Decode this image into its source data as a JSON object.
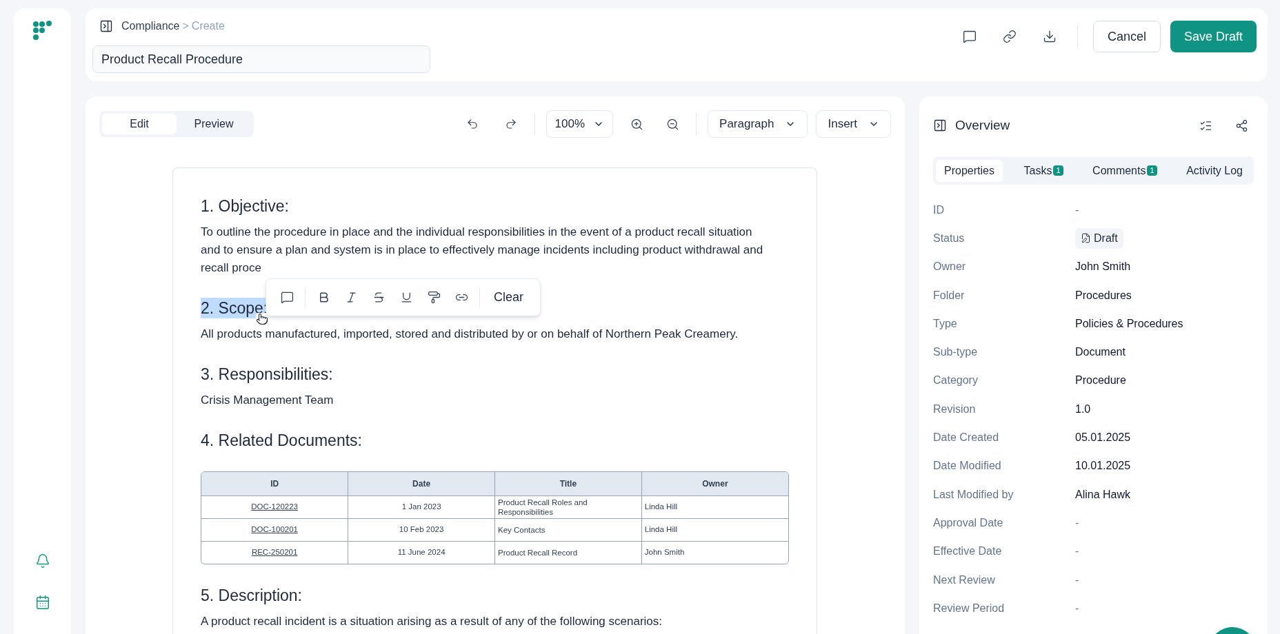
{
  "header": {
    "breadcrumb": [
      {
        "label": "Compliance",
        "current": false
      },
      {
        "label": "Create",
        "current": true
      }
    ],
    "breadcrumb_separator": ">",
    "title_field": {
      "value": "Product Recall Procedure"
    },
    "buttons": [
      {
        "label": "Cancel",
        "kind": "secondary"
      },
      {
        "label": "Save Draft",
        "kind": "primary"
      }
    ]
  },
  "editor": {
    "mode_tabs": [
      {
        "label": "Edit",
        "selected": true
      },
      {
        "label": "Preview",
        "selected": false
      }
    ],
    "zoom": "100%",
    "dropdowns": [
      "Paragraph",
      "Insert"
    ],
    "format_toolbar": {
      "clear": "Clear"
    },
    "blocks": [
      {
        "kind": "heading",
        "text": "1. Objective:",
        "selected": false
      },
      {
        "kind": "paragraph",
        "lines": [
          "To outline the procedure in place and the individual responsibilities in the event of a product recall situation",
          "and to ensure a plan and system is in place to effectively manage incidents including product withdrawal and",
          "recall proce"
        ]
      },
      {
        "kind": "heading",
        "text": "2. Scope:",
        "selected": true
      },
      {
        "kind": "paragraph",
        "lines": [
          "All products manufactured, imported, stored and distributed by or on behalf of Northern Peak Creamery."
        ]
      },
      {
        "kind": "heading",
        "text": "3. Responsibilities:",
        "selected": false
      },
      {
        "kind": "paragraph",
        "lines": [
          "Crisis Management Team"
        ]
      },
      {
        "kind": "heading",
        "text": "4. Related Documents:",
        "selected": false
      },
      {
        "kind": "table",
        "columns": [
          "ID",
          "Date",
          "Title",
          "Owner"
        ],
        "rows": [
          [
            "DOC-120223",
            "1 Jan 2023",
            "Product Recall Roles and Responsibilities",
            "Linda Hill"
          ],
          [
            "DOC-100201",
            "10 Feb 2023",
            "Key Contacts",
            "Linda Hill"
          ],
          [
            "REC-250201",
            "11 June 2024",
            "Product Recall Record",
            "John Smith"
          ]
        ]
      },
      {
        "kind": "heading",
        "text": "5. Description:",
        "selected": false
      },
      {
        "kind": "paragraph",
        "lines": [
          "A product recall incident is a situation arising as a result of any of the following scenarios:"
        ]
      }
    ]
  },
  "overview": {
    "title": "Overview",
    "tabs": [
      {
        "label": "Properties",
        "selected": true
      },
      {
        "label": "Tasks",
        "selected": false,
        "count": "1"
      },
      {
        "label": "Comments",
        "selected": false,
        "count": "1"
      },
      {
        "label": "Activity Log",
        "selected": false
      }
    ],
    "properties": [
      {
        "label": "ID",
        "value": "-",
        "kind": "text"
      },
      {
        "label": "Status",
        "value": "Draft",
        "kind": "badge"
      },
      {
        "label": "Owner",
        "value": "John Smith",
        "kind": "text"
      },
      {
        "label": "Folder",
        "value": "Procedures",
        "kind": "text"
      },
      {
        "label": "Type",
        "value": "Policies & Procedures",
        "kind": "text"
      },
      {
        "label": "Sub-type",
        "value": "Document",
        "kind": "text"
      },
      {
        "label": "Category",
        "value": "Procedure",
        "kind": "text"
      },
      {
        "label": "Revision",
        "value": "1.0",
        "kind": "text"
      },
      {
        "label": "Date Created",
        "value": "05.01.2025",
        "kind": "text"
      },
      {
        "label": "Date Modified",
        "value": "10.01.2025",
        "kind": "text"
      },
      {
        "label": "Last Modified by",
        "value": "Alina Hawk",
        "kind": "text"
      },
      {
        "label": "Approval Date",
        "value": "-",
        "kind": "text"
      },
      {
        "label": "Effective Date",
        "value": "-",
        "kind": "text"
      },
      {
        "label": "Next Review",
        "value": "-",
        "kind": "text"
      },
      {
        "label": "Review Period",
        "value": "-",
        "kind": "text"
      }
    ]
  }
}
